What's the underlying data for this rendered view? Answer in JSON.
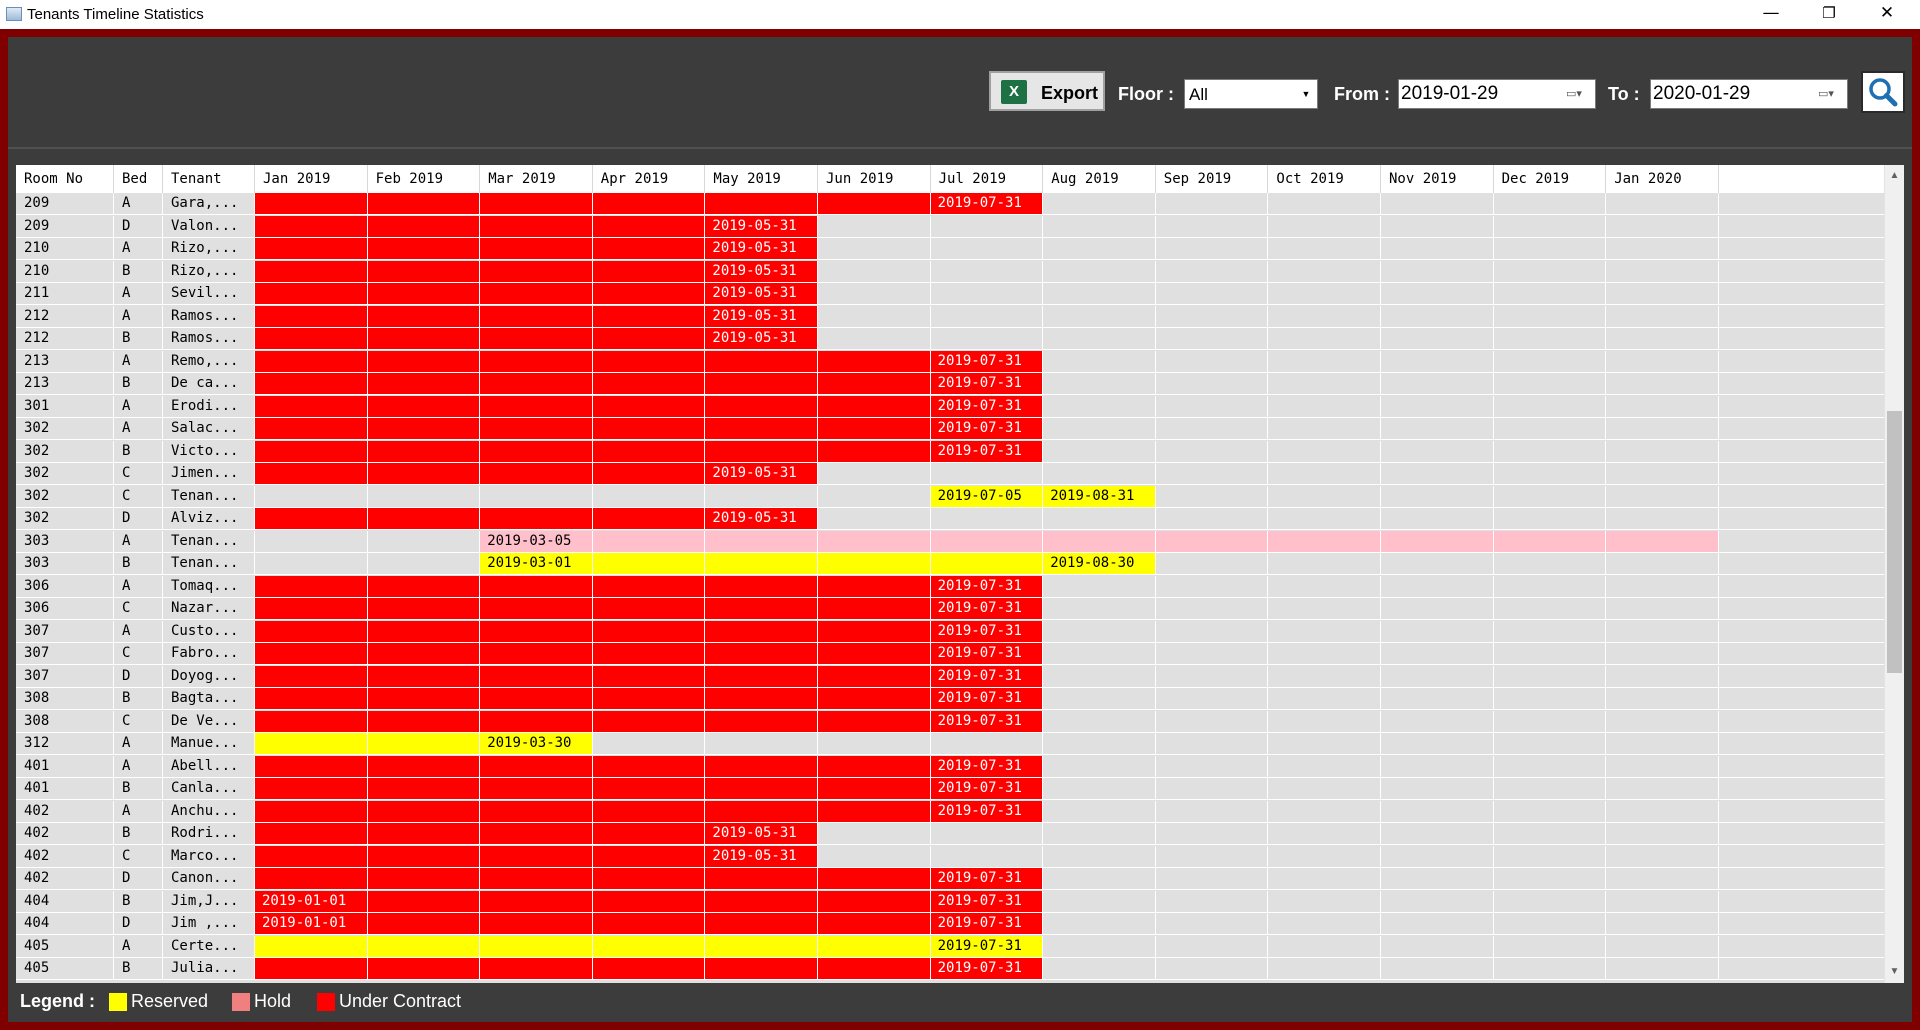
{
  "window": {
    "title": "Tenants Timeline Statistics",
    "minimize_glyph": "—",
    "restore_glyph": "❐",
    "close_glyph": "✕"
  },
  "toolbar": {
    "export_label": "Export",
    "export_icon_glyph": "X",
    "floor_label": "Floor :",
    "floor_value": "All",
    "from_label": "From :",
    "from_value": "2019-01-29",
    "to_label": "To :",
    "to_value": "2020-01-29",
    "search_icon": "magnifier-icon"
  },
  "colors": {
    "reserved": "#ffff00",
    "hold": "#ffc0cb",
    "under_contract": "#ff0000",
    "empty": "#e0e0e0"
  },
  "grid": {
    "columns": [
      "Room No",
      "Bed",
      "Tenant",
      "Jan 2019",
      "Feb 2019",
      "Mar 2019",
      "Apr 2019",
      "May 2019",
      "Jun 2019",
      "Jul 2019",
      "Aug 2019",
      "Sep 2019",
      "Oct 2019",
      "Nov 2019",
      "Dec 2019",
      "Jan 2020"
    ],
    "rows": [
      {
        "room": "209",
        "bed": "A",
        "tenant": "Gara,...",
        "cells": [
          "C",
          "C",
          "C",
          "C",
          "C",
          "C",
          "C:2019-07-31",
          "",
          "",
          "",
          "",
          "",
          ""
        ]
      },
      {
        "room": "209",
        "bed": "D",
        "tenant": "Valon...",
        "cells": [
          "C",
          "C",
          "C",
          "C",
          "C:2019-05-31",
          "",
          "",
          "",
          "",
          "",
          "",
          "",
          ""
        ]
      },
      {
        "room": "210",
        "bed": "A",
        "tenant": "Rizo,...",
        "cells": [
          "C",
          "C",
          "C",
          "C",
          "C:2019-05-31",
          "",
          "",
          "",
          "",
          "",
          "",
          "",
          ""
        ]
      },
      {
        "room": "210",
        "bed": "B",
        "tenant": "Rizo,...",
        "cells": [
          "C",
          "C",
          "C",
          "C",
          "C:2019-05-31",
          "",
          "",
          "",
          "",
          "",
          "",
          "",
          ""
        ]
      },
      {
        "room": "211",
        "bed": "A",
        "tenant": "Sevil...",
        "cells": [
          "C",
          "C",
          "C",
          "C",
          "C:2019-05-31",
          "",
          "",
          "",
          "",
          "",
          "",
          "",
          ""
        ]
      },
      {
        "room": "212",
        "bed": "A",
        "tenant": "Ramos...",
        "cells": [
          "C",
          "C",
          "C",
          "C",
          "C:2019-05-31",
          "",
          "",
          "",
          "",
          "",
          "",
          "",
          ""
        ]
      },
      {
        "room": "212",
        "bed": "B",
        "tenant": "Ramos...",
        "cells": [
          "C",
          "C",
          "C",
          "C",
          "C:2019-05-31",
          "",
          "",
          "",
          "",
          "",
          "",
          "",
          ""
        ]
      },
      {
        "room": "213",
        "bed": "A",
        "tenant": "Remo,...",
        "cells": [
          "C",
          "C",
          "C",
          "C",
          "C",
          "C",
          "C:2019-07-31",
          "",
          "",
          "",
          "",
          "",
          ""
        ]
      },
      {
        "room": "213",
        "bed": "B",
        "tenant": "De ca...",
        "cells": [
          "C",
          "C",
          "C",
          "C",
          "C",
          "C",
          "C:2019-07-31",
          "",
          "",
          "",
          "",
          "",
          ""
        ]
      },
      {
        "room": "301",
        "bed": "A",
        "tenant": "Erodi...",
        "cells": [
          "C",
          "C",
          "C",
          "C",
          "C",
          "C",
          "C:2019-07-31",
          "",
          "",
          "",
          "",
          "",
          ""
        ]
      },
      {
        "room": "302",
        "bed": "A",
        "tenant": "Salac...",
        "cells": [
          "C",
          "C",
          "C",
          "C",
          "C",
          "C",
          "C:2019-07-31",
          "",
          "",
          "",
          "",
          "",
          ""
        ]
      },
      {
        "room": "302",
        "bed": "B",
        "tenant": "Victo...",
        "cells": [
          "C",
          "C",
          "C",
          "C",
          "C",
          "C",
          "C:2019-07-31",
          "",
          "",
          "",
          "",
          "",
          ""
        ]
      },
      {
        "room": "302",
        "bed": "C",
        "tenant": "Jimen...",
        "cells": [
          "C",
          "C",
          "C",
          "C",
          "C:2019-05-31",
          "",
          "",
          "",
          "",
          "",
          "",
          "",
          ""
        ]
      },
      {
        "room": "302",
        "bed": "C",
        "tenant": "Tenan...",
        "cells": [
          "",
          "",
          "",
          "",
          "",
          "",
          "R:2019-07-05",
          "R:2019-08-31",
          "",
          "",
          "",
          "",
          ""
        ]
      },
      {
        "room": "302",
        "bed": "D",
        "tenant": "Alviz...",
        "cells": [
          "C",
          "C",
          "C",
          "C",
          "C:2019-05-31",
          "",
          "",
          "",
          "",
          "",
          "",
          "",
          ""
        ]
      },
      {
        "room": "303",
        "bed": "A",
        "tenant": "Tenan...",
        "cells": [
          "",
          "",
          "H:2019-03-05",
          "H",
          "H",
          "H",
          "H",
          "H",
          "H",
          "H",
          "H",
          "H",
          "H"
        ]
      },
      {
        "room": "303",
        "bed": "B",
        "tenant": "Tenan...",
        "cells": [
          "",
          "",
          "R:2019-03-01",
          "R",
          "R",
          "R",
          "R",
          "R:2019-08-30",
          "",
          "",
          "",
          "",
          ""
        ]
      },
      {
        "room": "306",
        "bed": "A",
        "tenant": "Tomaq...",
        "cells": [
          "C",
          "C",
          "C",
          "C",
          "C",
          "C",
          "C:2019-07-31",
          "",
          "",
          "",
          "",
          "",
          ""
        ]
      },
      {
        "room": "306",
        "bed": "C",
        "tenant": "Nazar...",
        "cells": [
          "C",
          "C",
          "C",
          "C",
          "C",
          "C",
          "C:2019-07-31",
          "",
          "",
          "",
          "",
          "",
          ""
        ]
      },
      {
        "room": "307",
        "bed": "A",
        "tenant": "Custo...",
        "cells": [
          "C",
          "C",
          "C",
          "C",
          "C",
          "C",
          "C:2019-07-31",
          "",
          "",
          "",
          "",
          "",
          ""
        ]
      },
      {
        "room": "307",
        "bed": "C",
        "tenant": "Fabro...",
        "cells": [
          "C",
          "C",
          "C",
          "C",
          "C",
          "C",
          "C:2019-07-31",
          "",
          "",
          "",
          "",
          "",
          ""
        ]
      },
      {
        "room": "307",
        "bed": "D",
        "tenant": "Doyog...",
        "cells": [
          "C",
          "C",
          "C",
          "C",
          "C",
          "C",
          "C:2019-07-31",
          "",
          "",
          "",
          "",
          "",
          ""
        ]
      },
      {
        "room": "308",
        "bed": "B",
        "tenant": "Bagta...",
        "cells": [
          "C",
          "C",
          "C",
          "C",
          "C",
          "C",
          "C:2019-07-31",
          "",
          "",
          "",
          "",
          "",
          ""
        ]
      },
      {
        "room": "308",
        "bed": "C",
        "tenant": "De Ve...",
        "cells": [
          "C",
          "C",
          "C",
          "C",
          "C",
          "C",
          "C:2019-07-31",
          "",
          "",
          "",
          "",
          "",
          ""
        ]
      },
      {
        "room": "312",
        "bed": "A",
        "tenant": "Manue...",
        "cells": [
          "R",
          "R",
          "R:2019-03-30",
          "",
          "",
          "",
          "",
          "",
          "",
          "",
          "",
          "",
          ""
        ]
      },
      {
        "room": "401",
        "bed": "A",
        "tenant": "Abell...",
        "cells": [
          "C",
          "C",
          "C",
          "C",
          "C",
          "C",
          "C:2019-07-31",
          "",
          "",
          "",
          "",
          "",
          ""
        ]
      },
      {
        "room": "401",
        "bed": "B",
        "tenant": "Canla...",
        "cells": [
          "C",
          "C",
          "C",
          "C",
          "C",
          "C",
          "C:2019-07-31",
          "",
          "",
          "",
          "",
          "",
          ""
        ]
      },
      {
        "room": "402",
        "bed": "A",
        "tenant": "Anchu...",
        "cells": [
          "C",
          "C",
          "C",
          "C",
          "C",
          "C",
          "C:2019-07-31",
          "",
          "",
          "",
          "",
          "",
          ""
        ]
      },
      {
        "room": "402",
        "bed": "B",
        "tenant": "Rodri...",
        "cells": [
          "C",
          "C",
          "C",
          "C",
          "C:2019-05-31",
          "",
          "",
          "",
          "",
          "",
          "",
          "",
          ""
        ]
      },
      {
        "room": "402",
        "bed": "C",
        "tenant": "Marco...",
        "cells": [
          "C",
          "C",
          "C",
          "C",
          "C:2019-05-31",
          "",
          "",
          "",
          "",
          "",
          "",
          "",
          ""
        ]
      },
      {
        "room": "402",
        "bed": "D",
        "tenant": "Canon...",
        "cells": [
          "C",
          "C",
          "C",
          "C",
          "C",
          "C",
          "C:2019-07-31",
          "",
          "",
          "",
          "",
          "",
          ""
        ]
      },
      {
        "room": "404",
        "bed": "B",
        "tenant": "Jim,J...",
        "cells": [
          "C:2019-01-01",
          "C",
          "C",
          "C",
          "C",
          "C",
          "C:2019-07-31",
          "",
          "",
          "",
          "",
          "",
          ""
        ]
      },
      {
        "room": "404",
        "bed": "D",
        "tenant": "Jim ,...",
        "cells": [
          "C:2019-01-01",
          "C",
          "C",
          "C",
          "C",
          "C",
          "C:2019-07-31",
          "",
          "",
          "",
          "",
          "",
          ""
        ]
      },
      {
        "room": "405",
        "bed": "A",
        "tenant": "Certe...",
        "cells": [
          "R",
          "R",
          "R",
          "R",
          "R",
          "R",
          "R:2019-07-31",
          "",
          "",
          "",
          "",
          "",
          ""
        ]
      },
      {
        "room": "405",
        "bed": "B",
        "tenant": "Julia...",
        "cells": [
          "C",
          "C",
          "C",
          "C",
          "C",
          "C",
          "C:2019-07-31",
          "",
          "",
          "",
          "",
          "",
          ""
        ]
      }
    ]
  },
  "scrollbar": {
    "up_glyph": "▲",
    "down_glyph": "▼"
  },
  "legend": {
    "title": "Legend :",
    "reserved": "Reserved",
    "hold": "Hold",
    "under_contract": "Under Contract"
  }
}
